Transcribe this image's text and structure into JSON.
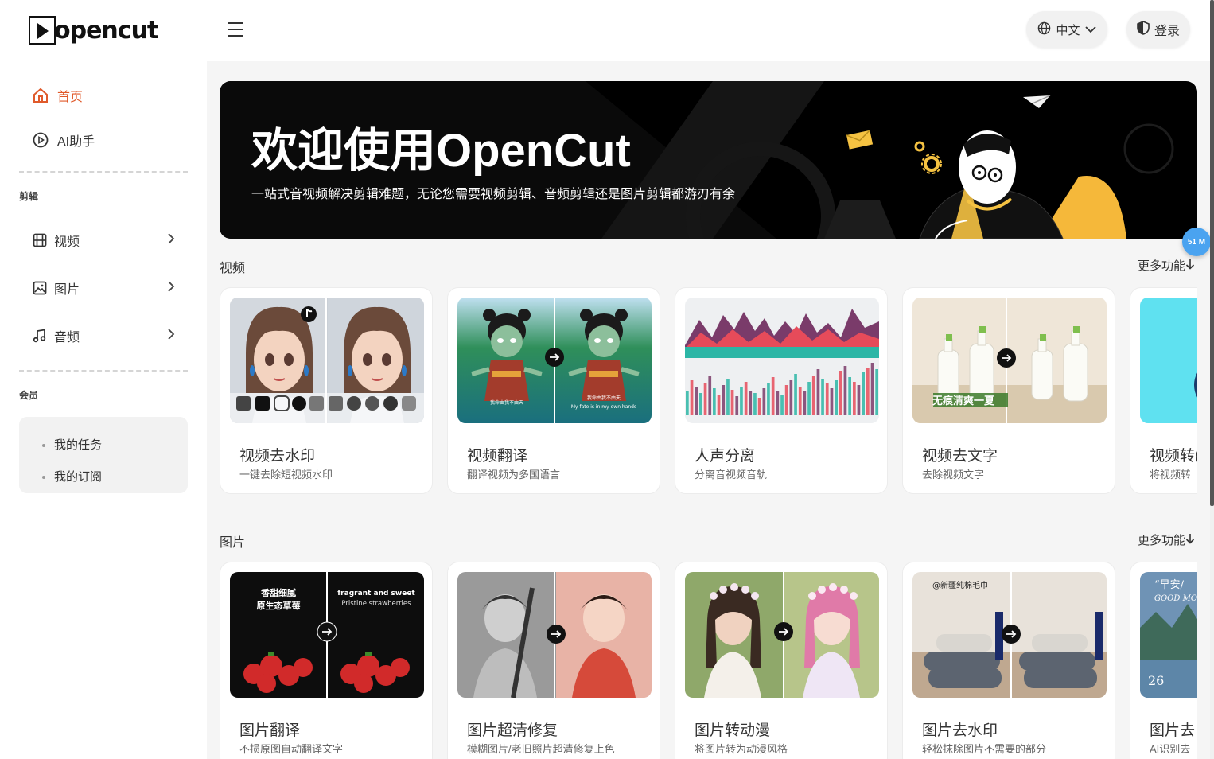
{
  "brand": {
    "logo_text": "opencut"
  },
  "sidebar": {
    "home": "首页",
    "ai": "AI助手",
    "edit_section": "剪辑",
    "edit_items": [
      {
        "label": "视频"
      },
      {
        "label": "图片"
      },
      {
        "label": "音频"
      }
    ],
    "member_section": "会员",
    "member_items": [
      {
        "label": "我的任务"
      },
      {
        "label": "我的订阅"
      }
    ]
  },
  "topbar": {
    "language": "中文",
    "login": "登录"
  },
  "banner": {
    "title": "欢迎使用OpenCut",
    "subtitle": "一站式音视频解决剪辑难题，无论您需要视频剪辑、音频剪辑还是图片剪辑都游刃有余"
  },
  "video_section": {
    "title": "视频",
    "more": "更多功能",
    "cards": [
      {
        "title": "视频去水印",
        "desc": "一键去除短视频水印"
      },
      {
        "title": "视频翻译",
        "desc": "翻译视频为多国语言"
      },
      {
        "title": "人声分离",
        "desc": "分离音视频音轨"
      },
      {
        "title": "视频去文字",
        "desc": "去除视频文字"
      },
      {
        "title": "视频转(",
        "desc": "将视频转"
      }
    ],
    "thumb_texts": {
      "translate_left": "我命由我不由天",
      "translate_right_1": "我命由我不由天",
      "translate_right_2": "My fate is in my own hands",
      "detext_overlay": "无痕清爽一夏"
    }
  },
  "image_section": {
    "title": "图片",
    "more": "更多功能",
    "cards": [
      {
        "title": "图片翻译",
        "desc": "不损原图自动翻译文字"
      },
      {
        "title": "图片超清修复",
        "desc": "模糊图片/老旧照片超清修复上色"
      },
      {
        "title": "图片转动漫",
        "desc": "将图片转为动漫风格"
      },
      {
        "title": "图片去水印",
        "desc": "轻松抹除图片不需要的部分"
      },
      {
        "title": "图片去",
        "desc": "AI识别去"
      }
    ],
    "thumb_texts": {
      "translate_left_1": "香甜细腻",
      "translate_left_2": "原生态草莓",
      "translate_right_1": "fragrant and sweet",
      "translate_right_2": "Pristine strawberries",
      "watermark_text": "@新疆纯棉毛巾",
      "poster_text_1": "“早安/",
      "poster_text_2": "GOOD MO",
      "poster_date": "26"
    }
  },
  "badge": "51 M",
  "colors": {
    "accent": "#e05a2b",
    "banner_bg": "#000000",
    "badge": "#4aa3f0"
  }
}
